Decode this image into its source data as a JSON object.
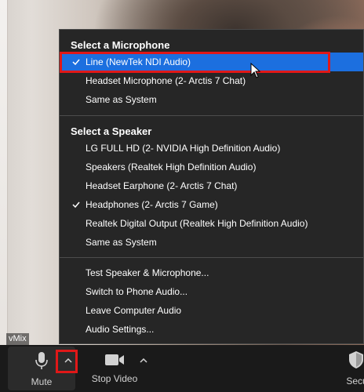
{
  "overlay": {
    "vmix_label": "vMix"
  },
  "menu": {
    "microphone_header": "Select a Microphone",
    "microphones": [
      {
        "label": "Line (NewTek NDI Audio)",
        "checked": true,
        "selected": true
      },
      {
        "label": "Headset Microphone (2- Arctis 7 Chat)",
        "checked": false,
        "selected": false
      },
      {
        "label": "Same as System",
        "checked": false,
        "selected": false
      }
    ],
    "speaker_header": "Select a Speaker",
    "speakers": [
      {
        "label": "LG FULL HD (2- NVIDIA High Definition Audio)",
        "checked": false
      },
      {
        "label": "Speakers (Realtek High Definition Audio)",
        "checked": false
      },
      {
        "label": "Headset Earphone (2- Arctis 7 Chat)",
        "checked": false
      },
      {
        "label": "Headphones (2- Arctis 7 Game)",
        "checked": true
      },
      {
        "label": "Realtek Digital Output (Realtek High Definition Audio)",
        "checked": false
      },
      {
        "label": "Same as System",
        "checked": false
      }
    ],
    "actions": [
      {
        "label": "Test Speaker & Microphone..."
      },
      {
        "label": "Switch to Phone Audio..."
      },
      {
        "label": "Leave Computer Audio"
      },
      {
        "label": "Audio Settings..."
      }
    ]
  },
  "toolbar": {
    "mute_label": "Mute",
    "stop_video_label": "Stop Video",
    "security_label": "Secu"
  },
  "icons": {
    "check": "check-icon",
    "microphone": "microphone-icon",
    "camera": "video-camera-icon",
    "caret": "caret-up-icon",
    "shield": "shield-icon",
    "cursor": "mouse-cursor-icon"
  },
  "colors": {
    "menu_bg": "#262626",
    "selected_bg": "#1c6fdf",
    "highlight_border": "#e01818",
    "toolbar_bg": "#1a1a1a"
  }
}
